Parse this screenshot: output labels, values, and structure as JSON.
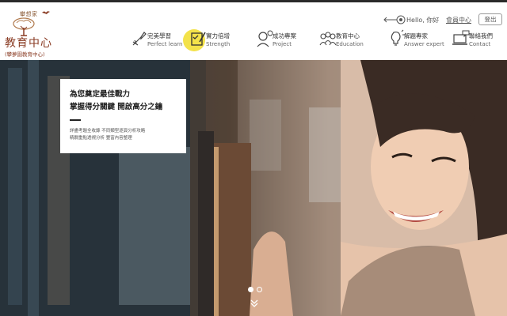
{
  "logo": {
    "top_text": "攀想家",
    "main": "教育中心",
    "sub": "(攀夢園教育中心)"
  },
  "nav": {
    "items": [
      {
        "zh": "完美學習",
        "en": "Perfect learn",
        "icon": "rocket-icon"
      },
      {
        "zh": "實力倍增",
        "en": "Strength",
        "icon": "checklist-pencil-icon"
      },
      {
        "zh": "成功專案",
        "en": "Project",
        "icon": "thinking-person-icon"
      },
      {
        "zh": "教育中心",
        "en": "Education",
        "icon": "group-people-icon"
      },
      {
        "zh": "解題專家",
        "en": "Answer expert",
        "icon": "lightbulb-head-icon"
      },
      {
        "zh": "聯絡我們",
        "en": "Contact",
        "icon": "laptop-chat-icon"
      }
    ],
    "active_index": 1,
    "highlight_color": "#f3e24a"
  },
  "user": {
    "greeting": "Hello, 你好",
    "member_link": "會員中心",
    "logout_label": "登出"
  },
  "hero": {
    "promo_title": "為您奠定最佳戰力",
    "promo_subtitle": "掌握得分關鍵  開啟高分之鑰",
    "promo_desc1": "詳盡考題全收錄 不同類型逐頁分析攻略",
    "promo_desc2": "精闢重點透視分析 豐富內容整理",
    "carousel_total": 2,
    "carousel_active": 1
  },
  "colors": {
    "brand": "#8a3c24",
    "accent": "#f3e24a",
    "topbar": "#2a2a2a"
  }
}
